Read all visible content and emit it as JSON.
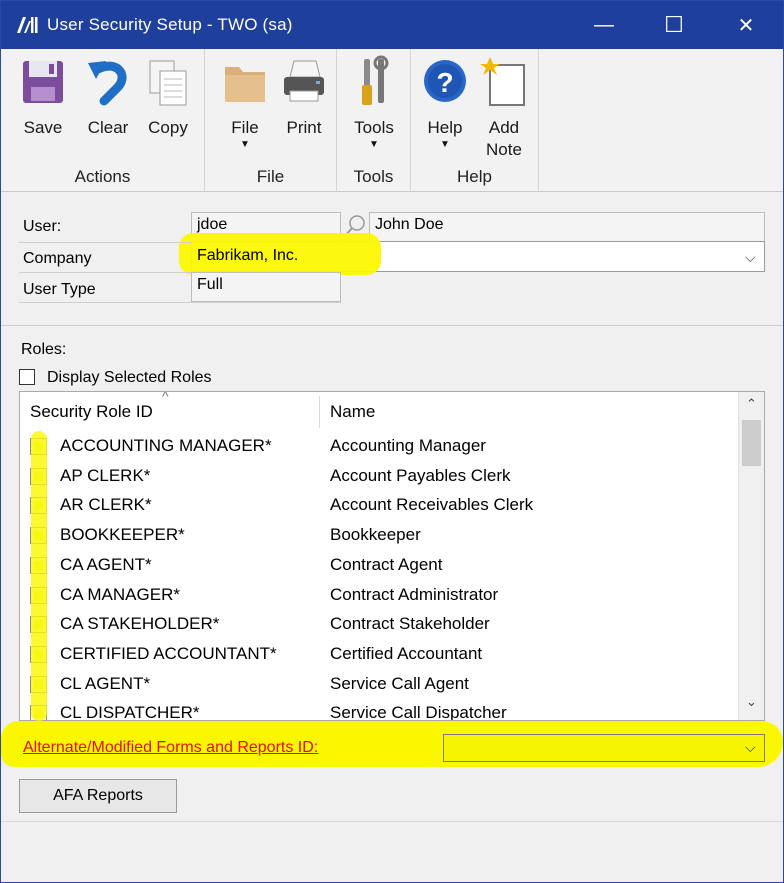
{
  "window": {
    "title": "User Security Setup  -  TWO (sa)",
    "controls": {
      "minimize": "—",
      "maximize": "☐",
      "close": "✕"
    },
    "accent": "#1f3f9d"
  },
  "ribbon": {
    "groups": [
      {
        "label": "Actions",
        "buttons": [
          {
            "label": "Save"
          },
          {
            "label": "Clear"
          },
          {
            "label": "Copy"
          }
        ]
      },
      {
        "label": "File",
        "buttons": [
          {
            "label": "File",
            "dropdown": "▼"
          },
          {
            "label": "Print"
          }
        ]
      },
      {
        "label": "Tools",
        "buttons": [
          {
            "label": "Tools",
            "dropdown": "▼"
          }
        ]
      },
      {
        "label": "Help",
        "buttons": [
          {
            "label": "Help",
            "dropdown": "▼"
          },
          {
            "label": "Add\nNote"
          }
        ]
      }
    ]
  },
  "fields": {
    "user_label": "User:",
    "user_id": "jdoe",
    "user_name": "John Doe",
    "company_label": "Company",
    "company_value": "Fabrikam, Inc.",
    "user_type_label": "User Type",
    "user_type_value": "Full"
  },
  "roles": {
    "section_label": "Roles:",
    "display_selected_label": "Display Selected Roles",
    "columns": {
      "id": "Security Role ID",
      "name": "Name"
    },
    "rows": [
      {
        "id": "ACCOUNTING MANAGER*",
        "name": "Accounting Manager"
      },
      {
        "id": "AP CLERK*",
        "name": "Account Payables Clerk"
      },
      {
        "id": "AR CLERK*",
        "name": "Account Receivables Clerk"
      },
      {
        "id": "BOOKKEEPER*",
        "name": "Bookkeeper"
      },
      {
        "id": "CA AGENT*",
        "name": "Contract Agent"
      },
      {
        "id": "CA MANAGER*",
        "name": "Contract Administrator"
      },
      {
        "id": "CA STAKEHOLDER*",
        "name": "Contract Stakeholder"
      },
      {
        "id": "CERTIFIED ACCOUNTANT*",
        "name": "Certified Accountant"
      },
      {
        "id": "CL AGENT*",
        "name": "Service Call Agent"
      },
      {
        "id": "CL DISPATCHER*",
        "name": "Service Call Dispatcher"
      }
    ]
  },
  "alt_forms": {
    "label": "Alternate/Modified Forms and Reports ID:",
    "value": ""
  },
  "buttons": {
    "afa_reports": "AFA Reports"
  },
  "colors": {
    "highlight": "#fbf700",
    "link_red": "#e01010"
  }
}
